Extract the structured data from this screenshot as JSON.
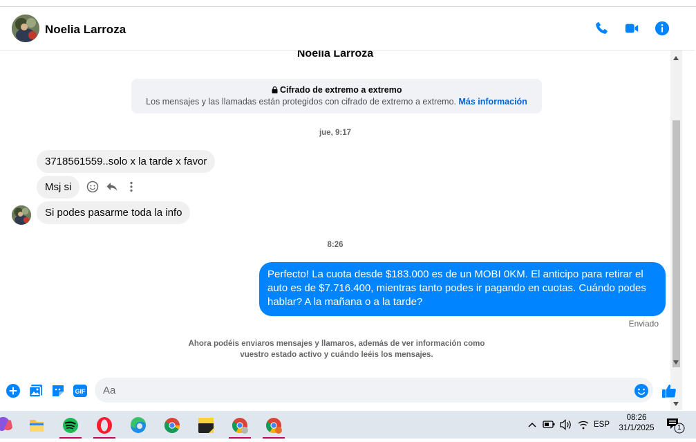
{
  "contact": {
    "name": "Noelia Larroza"
  },
  "encryption": {
    "title": "Cifrado de extremo a extremo",
    "body": "Los mensajes y las llamadas están protegidos con cifrado de extremo a extremo.",
    "link": "Más información"
  },
  "timestamps": {
    "first": "jue, 9:17",
    "second": "8:26"
  },
  "messages": {
    "incoming": [
      "3718561559..solo x la tarde x favor",
      "Msj si",
      "Si podes pasarme toda la info"
    ],
    "outgoing": "Perfecto! La cuota desde $183.000 es de un MOBI 0KM. El anticipo para retirar el auto es de $7.716.400, mientras tanto podes ir pagando en cuotas. Cuándo podes hablar? A la mañana o a la tarde?",
    "status": "Enviado"
  },
  "notice": "Ahora podéis enviaros mensajes y llamaros, además de ver información como vuestro estado activo y cuándo leéis los mensajes.",
  "composer": {
    "placeholder": "Aa"
  },
  "tray": {
    "language": "ESP",
    "time": "08:26",
    "date": "31/1/2025",
    "notifications": "1"
  },
  "colors": {
    "accent": "#0084ff",
    "link": "#0064d1",
    "incoming_bubble": "#f0f0f0"
  }
}
